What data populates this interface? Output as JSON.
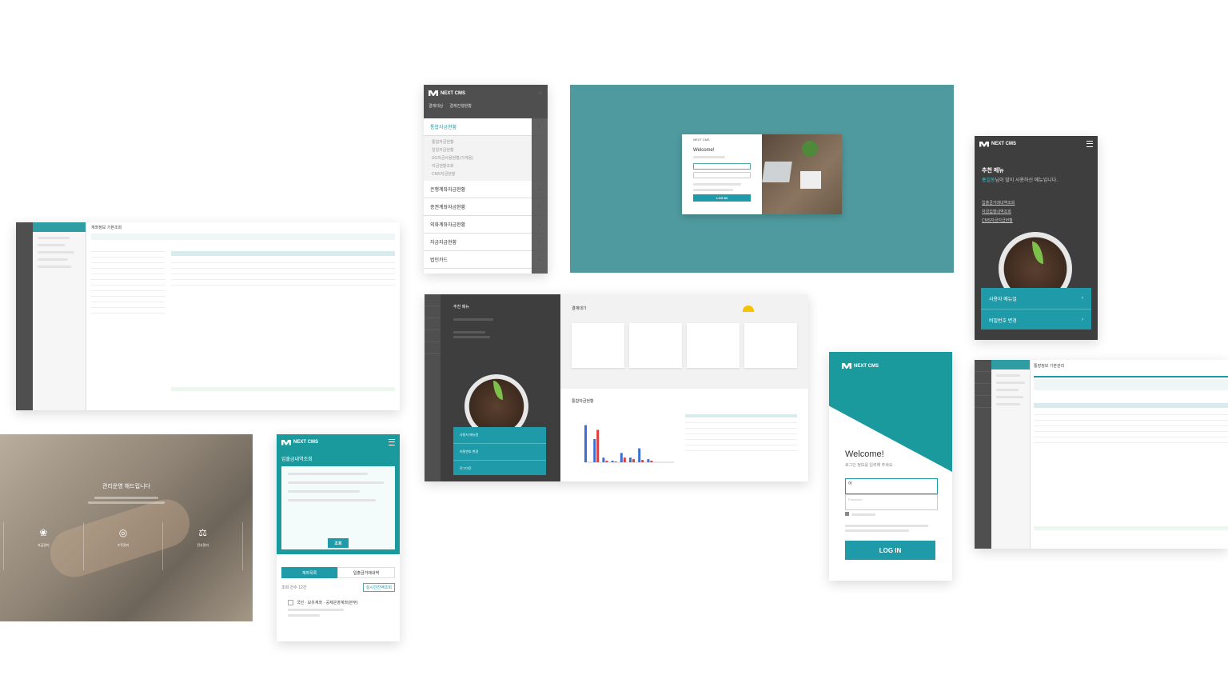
{
  "brand": {
    "name": "NEXT CMS",
    "accent": "#2f9ea4",
    "dark": "#4f4f50"
  },
  "mobile_menu": {
    "tabs": [
      "결제대상",
      "결제진행현황"
    ],
    "open_item": "통합자금현황",
    "sub_items": [
      "통합자금현황",
      "일일자금현황",
      "SG자금사용현황(가계용)",
      "자금현황조회",
      "CMS자금현황"
    ],
    "items": [
      "은행계좌자금현황",
      "증권계좌자금현황",
      "외화계좌자금현황",
      "자금지급현황",
      "법인카드"
    ]
  },
  "login_wide": {
    "title": "Welcome!",
    "button": "LOG IN"
  },
  "recommend": {
    "title": "추천 메뉴",
    "subtitle_highlight": "홍길동",
    "subtitle": "님이 많이 사용하신 메뉴입니다.",
    "links": [
      "입출금거래내역조회",
      "자금집행내역조회",
      "CMS자금지급현황"
    ],
    "buttons": [
      "사용자 매뉴얼",
      "비밀번호 변경"
    ]
  },
  "dashboard": {
    "menu_title": "추천 메뉴",
    "approval_title": "결재대기",
    "chart_title": "통합자금현황",
    "chart_buttons": [
      "사용자 매뉴얼",
      "비밀번호 변경",
      "로그아웃"
    ],
    "chart_data": {
      "type": "bar",
      "categories": [
        "",
        "",
        "",
        "",
        "",
        "",
        "",
        "",
        "",
        ""
      ],
      "series": [
        {
          "values": [
            48,
            30,
            6,
            2,
            12,
            6,
            18,
            4,
            0,
            0
          ]
        },
        {
          "values": [
            0,
            42,
            2,
            1,
            6,
            4,
            3,
            2,
            0,
            0
          ]
        }
      ],
      "ylim": [
        0,
        60
      ]
    }
  },
  "login_mobile": {
    "title": "Welcome!",
    "subtitle": "로그인 정보를 입력해 주세요.",
    "id_value": "아",
    "password_placeholder": "Password",
    "button": "LOG IN"
  },
  "handshake": {
    "title": "관리운영 해드립니다",
    "items": [
      "자금관리",
      "수주관리",
      "전사관리"
    ]
  },
  "mobile_inquiry": {
    "title": "입출금내역조회",
    "search_button": "조회",
    "tabs": [
      "계좌목록",
      "입출금거래내역"
    ],
    "count": "조회 건수 12건",
    "realtime_button": "실시간잔액조회",
    "row_text": "국민 · 보유계좌 · 공제운영계좌(본부)"
  },
  "admin_left": {
    "title": "계좌정보 기본조회"
  },
  "admin_right": {
    "title": "통장정보 기본관리"
  }
}
